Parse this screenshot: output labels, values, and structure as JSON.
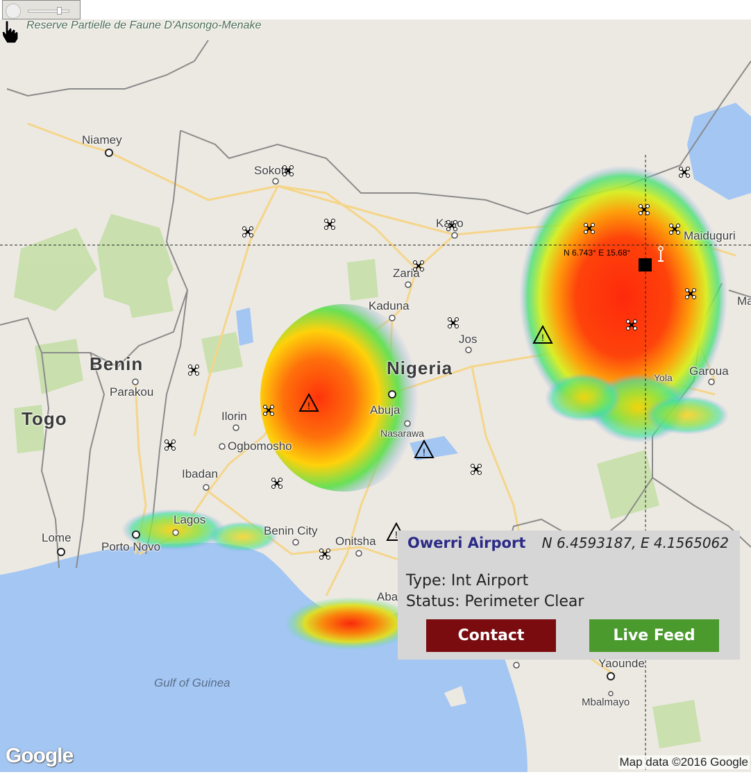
{
  "map": {
    "labels": [
      {
        "name": "city",
        "text": "Niamey",
        "cls": "city"
      },
      {
        "name": "city",
        "text": "Sokoto",
        "cls": "city"
      },
      {
        "name": "city",
        "text": "Kano",
        "cls": "city"
      },
      {
        "name": "city",
        "text": "Zaria",
        "cls": "city"
      },
      {
        "name": "city",
        "text": "Kaduna",
        "cls": "city"
      },
      {
        "name": "city",
        "text": "Jos",
        "cls": "city"
      },
      {
        "name": "city",
        "text": "Abuja",
        "cls": "city"
      },
      {
        "name": "city",
        "text": "Nasarawa",
        "cls": "city"
      },
      {
        "name": "city",
        "text": "Ilorin",
        "cls": "city"
      },
      {
        "name": "city",
        "text": "Ogbomosho",
        "cls": "city"
      },
      {
        "name": "city",
        "text": "Ibadan",
        "cls": "city"
      },
      {
        "name": "city",
        "text": "Lagos",
        "cls": "city"
      },
      {
        "name": "city",
        "text": "Porto Novo",
        "cls": "city"
      },
      {
        "name": "city",
        "text": "Lome",
        "cls": "city"
      },
      {
        "name": "city",
        "text": "Benin City",
        "cls": "city"
      },
      {
        "name": "city",
        "text": "Onitsha",
        "cls": "city"
      },
      {
        "name": "city",
        "text": "Parakou",
        "cls": "city"
      },
      {
        "name": "city",
        "text": "Yola",
        "cls": "city"
      },
      {
        "name": "city",
        "text": "Garoua",
        "cls": "city"
      },
      {
        "name": "city",
        "text": "Maiduguri",
        "cls": "city"
      },
      {
        "name": "city",
        "text": "Ma",
        "cls": "city"
      },
      {
        "name": "city",
        "text": "Yaounde",
        "cls": "city"
      },
      {
        "name": "city",
        "text": "Mbalmayo",
        "cls": "city"
      },
      {
        "name": "city",
        "text": "Aba",
        "cls": "city"
      },
      {
        "name": "country",
        "text": "Nigeria",
        "cls": "country"
      },
      {
        "name": "country",
        "text": "Benin",
        "cls": "country"
      },
      {
        "name": "country",
        "text": "Togo",
        "cls": "country"
      },
      {
        "name": "sea",
        "text": "Gulf of Guinea",
        "cls": "sea"
      },
      {
        "name": "reserve",
        "text": "Reserve Partielle de Faune D'Ansongo-Menake",
        "cls": "reserve"
      }
    ],
    "crosshair_label": "N 6.743° E 15.68°",
    "attribution": "Map data ©2016 Google",
    "logo": "Google",
    "colors": {
      "land": "#ece9e2",
      "water": "#a4c6f3",
      "park": "#c6dfa8",
      "road": "#f5d58a",
      "border": "#8a8a8a"
    }
  },
  "popup": {
    "title": "Owerri Airport",
    "coords": "N 6.4593187, E 4.1565062",
    "type": "Type: Int Airport",
    "status": "Status: Perimeter Clear",
    "contact_label": "Contact",
    "live_label": "Live Feed",
    "colors": {
      "contact": "#7a0c10",
      "live": "#4a9a2e",
      "title": "#2b2a86"
    }
  }
}
